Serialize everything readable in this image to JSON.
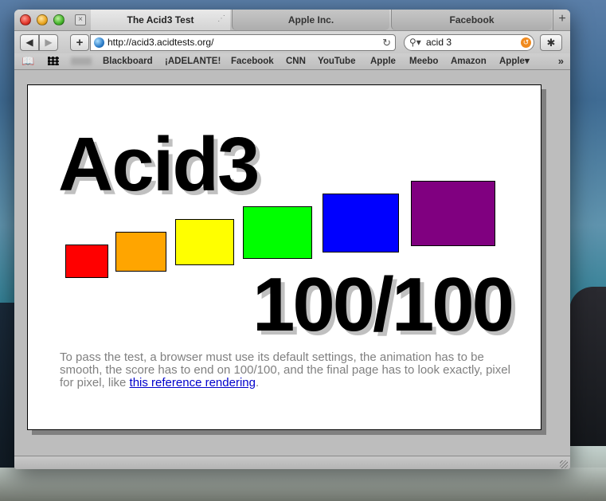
{
  "tabs": [
    {
      "label": "The Acid3 Test",
      "active": true
    },
    {
      "label": "Apple Inc.",
      "active": false
    },
    {
      "label": "Facebook",
      "active": false
    }
  ],
  "new_tab_label": "+",
  "toolbar": {
    "back_label": "◀",
    "forward_label": "▶",
    "add_label": "+",
    "url": "http://acid3.acidtests.org/",
    "reload_label": "↻",
    "search_query": "acid 3",
    "bug_label": "✱"
  },
  "bookmarks": {
    "items": [
      "Blackboard",
      "¡ADELANTE!",
      "Facebook",
      "CNN",
      "YouTube",
      "Apple",
      "Meebo",
      "Amazon",
      "Apple▾"
    ],
    "more_label": "»"
  },
  "page": {
    "title": "Acid3",
    "score": "100/100",
    "description_prefix": "To pass the test, a browser must use its default settings, the animation has to be smooth, the score has to end on 100/100, and the final page has to look exactly, pixel for pixel, like ",
    "link_text": "this reference rendering",
    "description_suffix": "."
  },
  "boxes": {
    "colors": [
      "#ff0000",
      "#ffa500",
      "#ffff00",
      "#00ff00",
      "#0000ff",
      "#800080"
    ]
  }
}
